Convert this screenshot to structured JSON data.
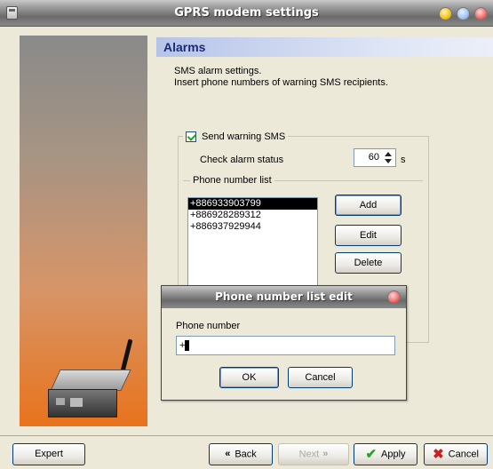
{
  "window": {
    "title": "GPRS modem settings"
  },
  "section": {
    "title": "Alarms",
    "description_line1": "SMS alarm settings.",
    "description_line2": "Insert phone numbers of warning SMS recipients."
  },
  "sms": {
    "send_warning_label": "Send warning SMS",
    "send_warning_checked": true,
    "check_alarm_label": "Check alarm status",
    "check_alarm_value": "60",
    "check_alarm_unit": "s"
  },
  "phone_list": {
    "label": "Phone number list",
    "items": [
      "+886933903799",
      "+886928289312",
      "+886937929944"
    ],
    "selected_index": 0,
    "buttons": {
      "add": "Add",
      "edit": "Edit",
      "delete": "Delete"
    }
  },
  "dialog": {
    "title": "Phone number list edit",
    "field_label": "Phone number",
    "field_value": "+",
    "ok": "OK",
    "cancel": "Cancel"
  },
  "footer": {
    "expert": "Expert",
    "back": "Back",
    "next": "Next",
    "apply": "Apply",
    "cancel": "Cancel"
  },
  "icons": {
    "back": "double-chevron-left-icon",
    "next": "double-chevron-right-icon",
    "apply": "checkmark-icon",
    "cancel": "x-icon"
  }
}
